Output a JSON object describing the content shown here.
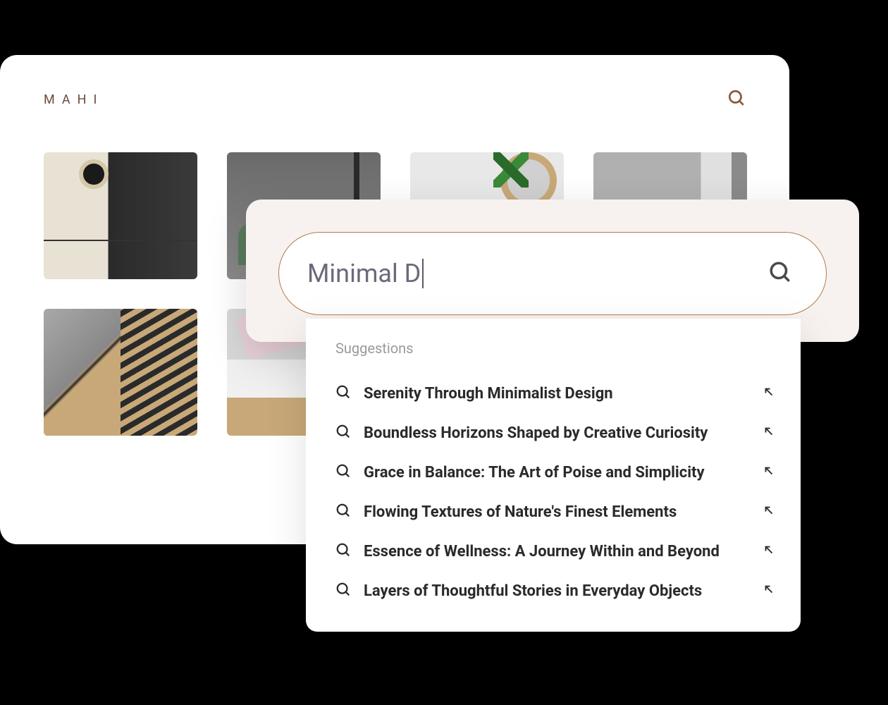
{
  "brand": {
    "logo": "MAHI"
  },
  "search": {
    "value": "Minimal D",
    "suggestions_label": "Suggestions",
    "suggestions": [
      {
        "text": "Serenity Through Minimalist Design"
      },
      {
        "text": "Boundless Horizons Shaped by Creative Curiosity"
      },
      {
        "text": "Grace in Balance: The Art of Poise and Simplicity"
      },
      {
        "text": "Flowing Textures of Nature's Finest Elements"
      },
      {
        "text": "Essence of Wellness: A Journey Within and Beyond"
      },
      {
        "text": "Layers of Thoughtful Stories in Everyday Objects"
      }
    ]
  },
  "colors": {
    "accent": "#b87a4a",
    "overlay_bg": "#f7f2ef"
  }
}
